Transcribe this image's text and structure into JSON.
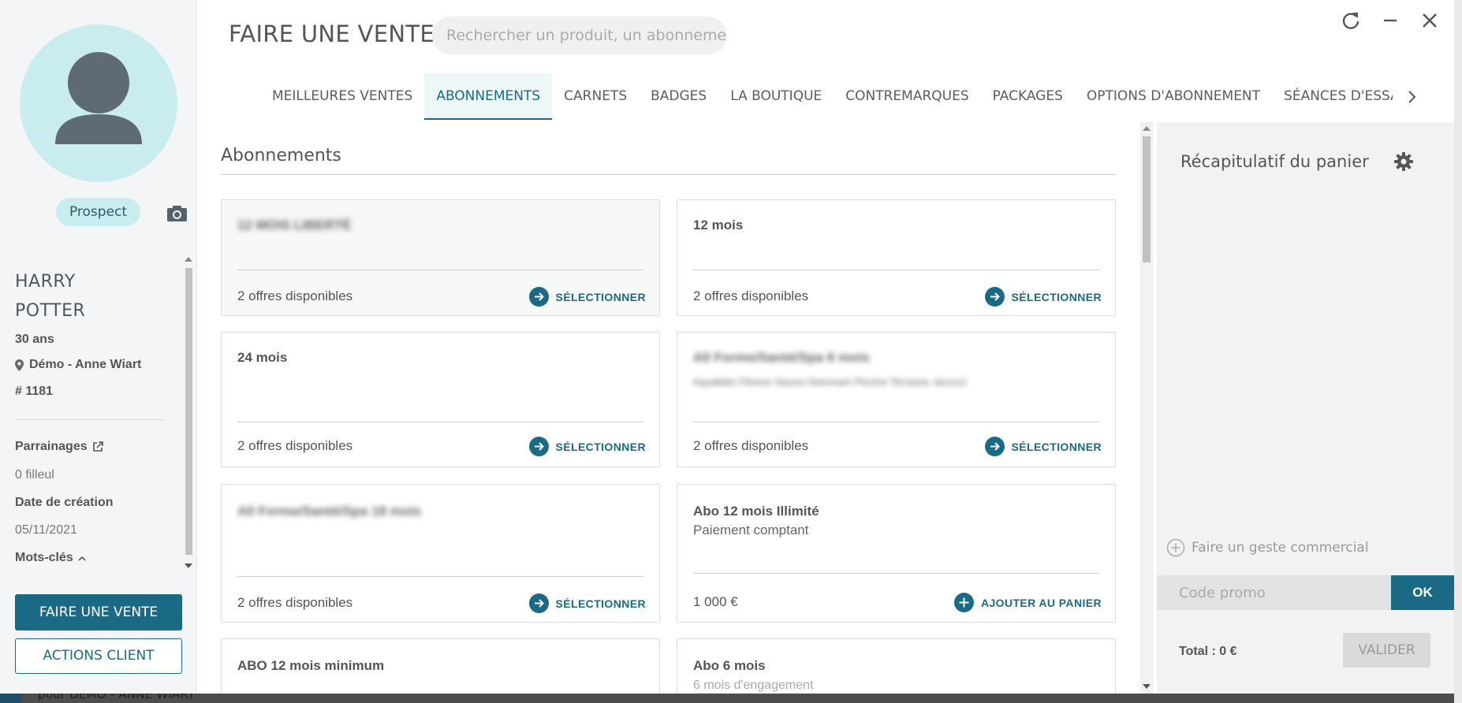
{
  "background": {
    "agency_text": "pour DÉMO - ANNE WIART"
  },
  "customer": {
    "status": "Prospect",
    "first_name": "HARRY",
    "last_name": "POTTER",
    "age": "30 ans",
    "location": "Démo - Anne Wiart",
    "id": "# 1181",
    "parrainages_label": "Parrainages",
    "filleul": "0 filleul",
    "date_label": "Date de création",
    "date_value": "05/11/2021",
    "keywords_label": "Mots-clés"
  },
  "sidebar_buttons": {
    "sale": "FAIRE UNE VENTE",
    "actions": "ACTIONS CLIENT"
  },
  "header": {
    "title": "FAIRE UNE VENTE",
    "search_placeholder": "Rechercher un produit, un abonnement"
  },
  "tabs": [
    {
      "label": "MEILLEURES VENTES"
    },
    {
      "label": "ABONNEMENTS"
    },
    {
      "label": "CARNETS"
    },
    {
      "label": "BADGES"
    },
    {
      "label": "LA BOUTIQUE"
    },
    {
      "label": "CONTREMARQUES"
    },
    {
      "label": "PACKAGES"
    },
    {
      "label": "OPTIONS D'ABONNEMENT"
    },
    {
      "label": "SÉANCES D'ESSAI"
    }
  ],
  "active_tab": "ABONNEMENTS",
  "section_title": "Abonnements",
  "cards": [
    {
      "title": "12 MOIS LIBERTÉ",
      "subtitle": "",
      "footer": "2 offres disponibles",
      "action": "SÉLECTIONNER"
    },
    {
      "title": "12 mois",
      "subtitle": "",
      "footer": "2 offres disponibles",
      "action": "SÉLECTIONNER"
    },
    {
      "title": "24 mois",
      "subtitle": "",
      "footer": "2 offres disponibles",
      "action": "SÉLECTIONNER"
    },
    {
      "title": "All Forme/Santé/Spa 6 mois",
      "subtitle": "Aquabike Fitness Sauna Hammam Piscine Terrasse Jacuzzi",
      "footer": "2 offres disponibles",
      "action": "SÉLECTIONNER"
    },
    {
      "title": "All Forme/Santé/Spa 18 mois",
      "subtitle": "",
      "footer": "2 offres disponibles",
      "action": "SÉLECTIONNER"
    },
    {
      "title": "Abo 12 mois Illimité",
      "subtitle": "Paiement comptant",
      "footer": "1 000 €",
      "action": "AJOUTER AU PANIER"
    },
    {
      "title": "ABO 12 mois minimum",
      "subtitle": "",
      "footer": "",
      "action": ""
    },
    {
      "title": "Abo 6 mois",
      "subtitle": "6 mois d'engagement",
      "footer": "",
      "action": ""
    }
  ],
  "cart": {
    "title": "Récapitulatif du panier",
    "geste_label": "Faire un geste commercial",
    "promo_placeholder": "Code promo",
    "ok_label": "OK",
    "total": "Total : 0 €",
    "validate_label": "VALIDER"
  },
  "colors": {
    "accent": "#1a6a85",
    "avatar_bg": "#c9ecef"
  }
}
